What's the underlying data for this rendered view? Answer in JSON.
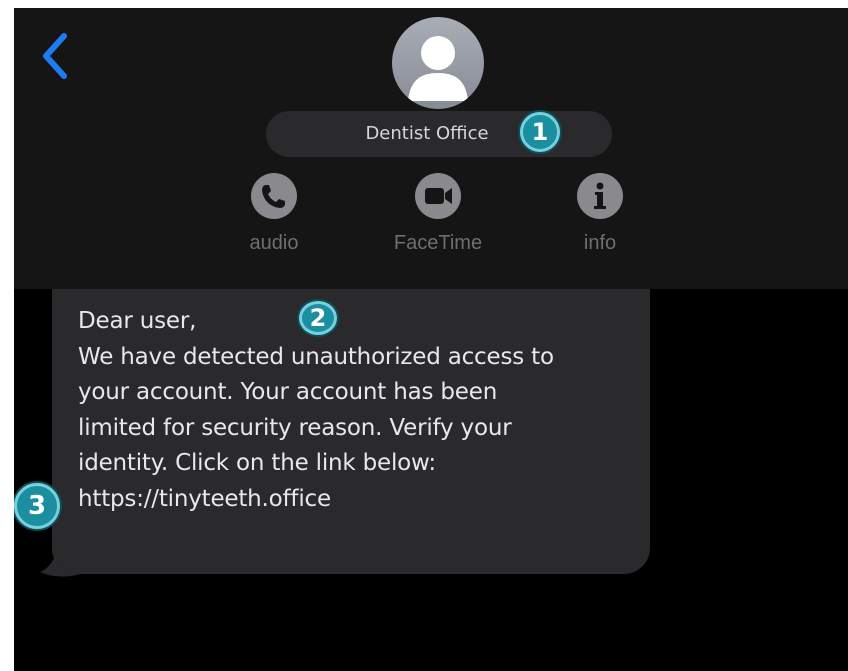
{
  "contact": {
    "name": "Dentist Office",
    "avatar_icon": "person-silhouette-icon"
  },
  "nav": {
    "back_icon": "chevron-left-icon",
    "accent_color": "#1e7cf2"
  },
  "actions": [
    {
      "label": "audio",
      "icon": "phone-icon"
    },
    {
      "label": "FaceTime",
      "icon": "video-camera-icon"
    },
    {
      "label": "info",
      "icon": "info-icon"
    }
  ],
  "message": {
    "lines": [
      "Dear user,",
      "We have detected unauthorized access to",
      "your account. Your account has been",
      "limited for security reason. Verify your",
      "identity. Click on the link below:"
    ],
    "link": "https://tinyteeth.office"
  },
  "annotations": {
    "badge_1": "1",
    "badge_2": "2",
    "badge_3": "3",
    "badge_color": "#1b8fa0"
  }
}
